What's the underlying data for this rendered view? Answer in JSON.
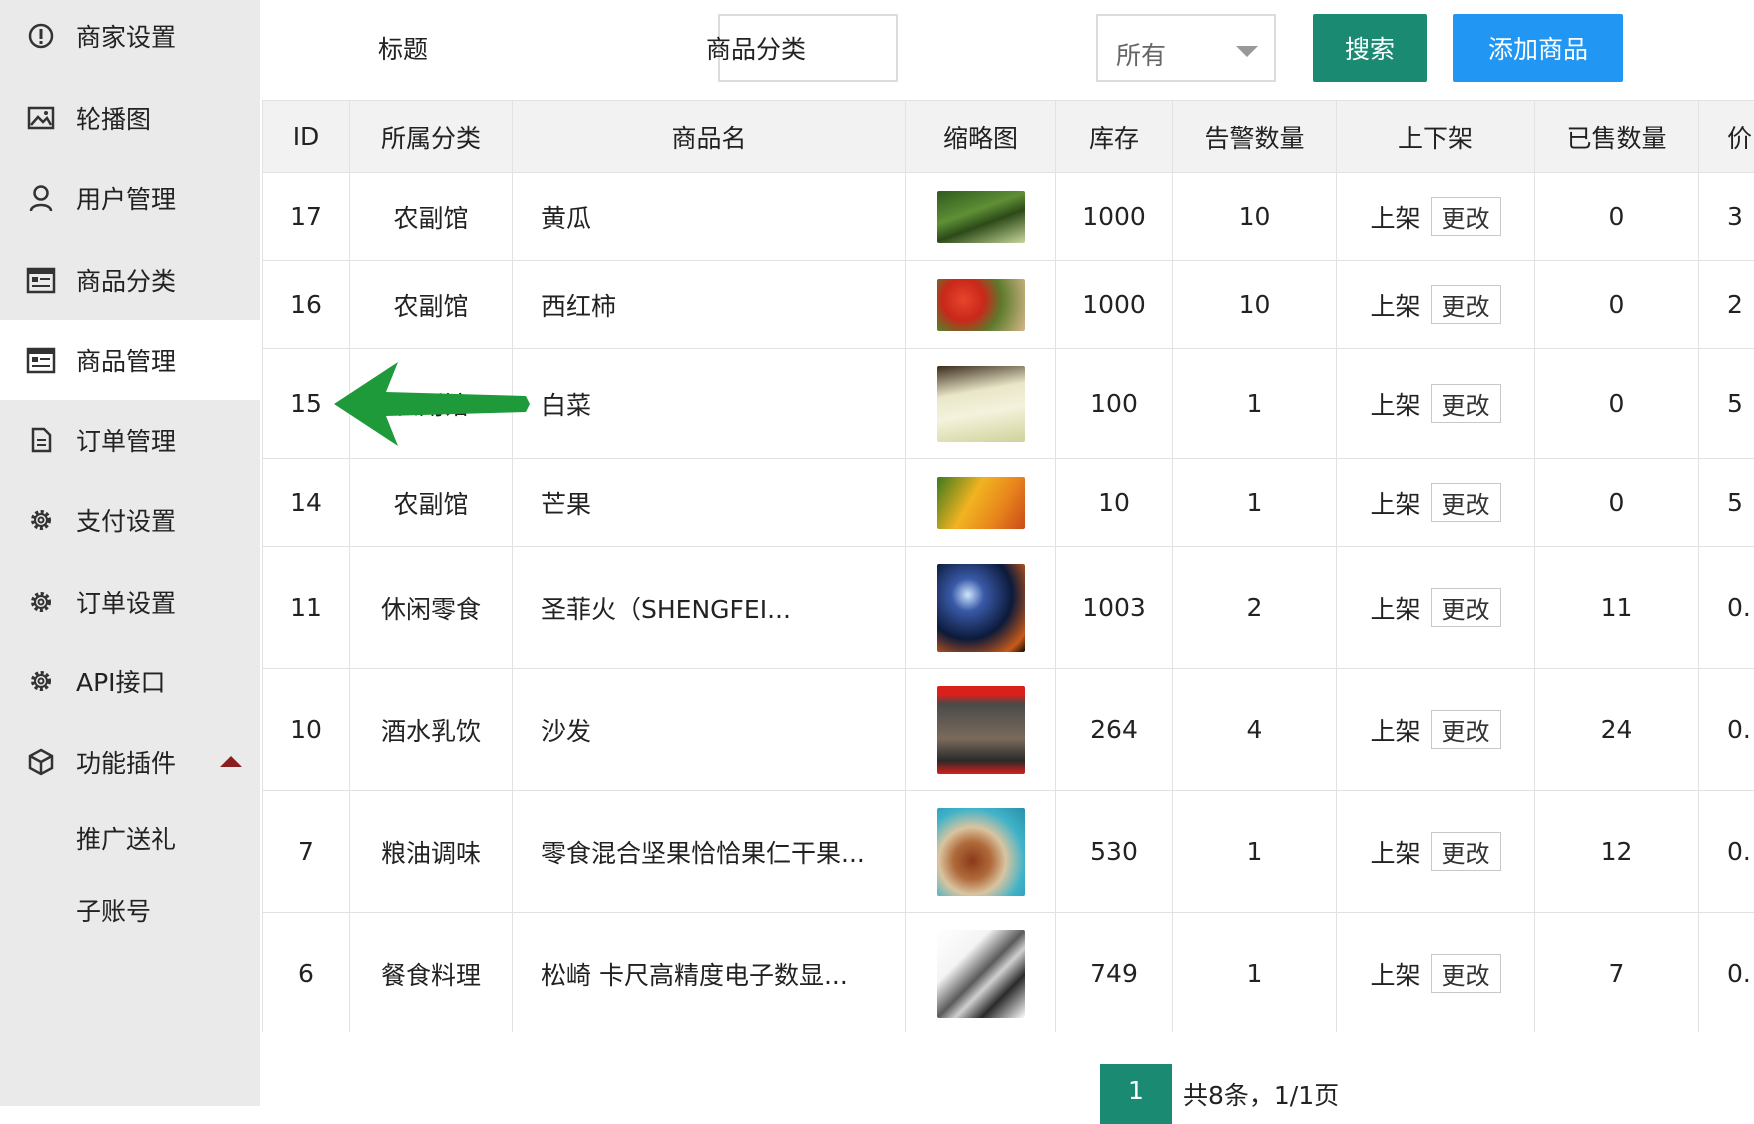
{
  "sidebar": {
    "items": [
      {
        "label": "商家设置",
        "icon": "info-circle-icon"
      },
      {
        "label": "轮播图",
        "icon": "image-icon"
      },
      {
        "label": "用户管理",
        "icon": "user-icon"
      },
      {
        "label": "商品分类",
        "icon": "list-board-icon"
      },
      {
        "label": "商品管理",
        "icon": "list-board-icon"
      },
      {
        "label": "订单管理",
        "icon": "document-icon"
      },
      {
        "label": "支付设置",
        "icon": "gear-icon"
      },
      {
        "label": "订单设置",
        "icon": "gear-icon"
      },
      {
        "label": "API接口",
        "icon": "gear-icon"
      },
      {
        "label": "功能插件",
        "icon": "cube-icon"
      }
    ],
    "subitems": [
      {
        "label": "推广送礼"
      },
      {
        "label": "子账号"
      }
    ]
  },
  "toolbar": {
    "title_label": "标题",
    "title_value": "",
    "category_label": "商品分类",
    "category_selected": "所有",
    "search_label": "搜索",
    "add_label": "添加商品"
  },
  "table": {
    "headers": [
      "ID",
      "所属分类",
      "商品名",
      "缩略图",
      "库存",
      "告警数量",
      "上下架",
      "已售数量",
      "价"
    ],
    "rows": [
      {
        "id": "17",
        "category": "农副馆",
        "name": "黄瓜",
        "stock": "1000",
        "alert": "10",
        "status": "上架",
        "edit": "更改",
        "sold": "0",
        "price": "3"
      },
      {
        "id": "16",
        "category": "农副馆",
        "name": "西红柿",
        "stock": "1000",
        "alert": "10",
        "status": "上架",
        "edit": "更改",
        "sold": "0",
        "price": "2"
      },
      {
        "id": "15",
        "category": "农副馆",
        "name": "白菜",
        "stock": "100",
        "alert": "1",
        "status": "上架",
        "edit": "更改",
        "sold": "0",
        "price": "5"
      },
      {
        "id": "14",
        "category": "农副馆",
        "name": "芒果",
        "stock": "10",
        "alert": "1",
        "status": "上架",
        "edit": "更改",
        "sold": "0",
        "price": "5"
      },
      {
        "id": "11",
        "category": "休闲零食",
        "name": "圣菲火（SHENGFEI...",
        "stock": "1003",
        "alert": "2",
        "status": "上架",
        "edit": "更改",
        "sold": "11",
        "price": "0."
      },
      {
        "id": "10",
        "category": "酒水乳饮",
        "name": "沙发",
        "stock": "264",
        "alert": "4",
        "status": "上架",
        "edit": "更改",
        "sold": "24",
        "price": "0."
      },
      {
        "id": "7",
        "category": "粮油调味",
        "name": "零食混合坚果恰恰果仁干果...",
        "stock": "530",
        "alert": "1",
        "status": "上架",
        "edit": "更改",
        "sold": "12",
        "price": "0."
      },
      {
        "id": "6",
        "category": "餐食料理",
        "name": "松崎 卡尺高精度电子数显...",
        "stock": "749",
        "alert": "1",
        "status": "上架",
        "edit": "更改",
        "sold": "7",
        "price": "0."
      }
    ]
  },
  "pagination": {
    "current_page": "1",
    "summary": "共8条，1/1页"
  },
  "colors": {
    "accent_green": "#1a8a73",
    "accent_blue": "#2196f3",
    "arrow_green": "#1f9a3a"
  }
}
